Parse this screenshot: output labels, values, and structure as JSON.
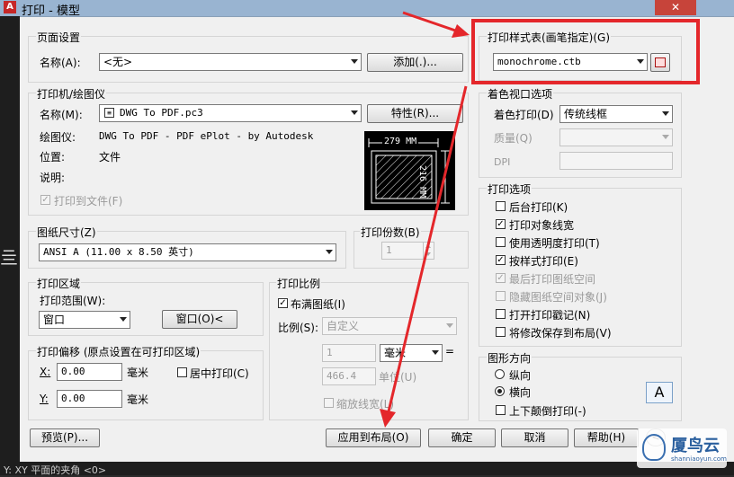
{
  "window": {
    "title": "打印 - 模型",
    "close_glyph": "✕",
    "app_icon": "autocad-icon"
  },
  "page_setup": {
    "group_title": "页面设置",
    "name_label": "名称(A):",
    "name_value": "<无>",
    "add_button": "添加(.)..."
  },
  "printer": {
    "group_title": "打印机/绘图仪",
    "name_label": "名称(M):",
    "name_value": "DWG To PDF.pc3",
    "properties_button": "特性(R)...",
    "plotter_label": "绘图仪:",
    "plotter_value": "DWG To PDF - PDF ePlot - by Autodesk",
    "location_label": "位置:",
    "location_value": "文件",
    "description_label": "说明:",
    "plot_to_file_label": "打印到文件(F)",
    "preview_width": "279 MM",
    "preview_height": "216 MM"
  },
  "paper_size": {
    "group_title": "图纸尺寸(Z)",
    "value": "ANSI A (11.00 x 8.50 英寸)"
  },
  "copies": {
    "group_title": "打印份数(B)",
    "value": "1"
  },
  "plot_area": {
    "group_title": "打印区域",
    "what_label": "打印范围(W):",
    "what_value": "窗口",
    "window_button": "窗口(O)<"
  },
  "plot_offset": {
    "group_title": "打印偏移 (原点设置在可打印区域)",
    "x_label": "X:",
    "x_value": "0.00",
    "y_label": "Y:",
    "y_value": "0.00",
    "unit_x": "毫米",
    "unit_y": "毫米",
    "center_label": "居中打印(C)"
  },
  "plot_scale": {
    "group_title": "打印比例",
    "fit_label": "布满图纸(I)",
    "scale_label": "比例(S):",
    "scale_value": "自定义",
    "value1": "1",
    "unit_value": "毫米",
    "equals": "=",
    "value2": "466.4",
    "unit2": "单位(U)",
    "lineweights_label": "缩放线宽(L)"
  },
  "plot_style_table": {
    "group_title": "打印样式表(画笔指定)(G)",
    "value": "monochrome.ctb",
    "edit_icon": "edit-table-icon"
  },
  "shaded_viewport": {
    "group_title": "着色视口选项",
    "shade_label": "着色打印(D)",
    "shade_value": "传统线框",
    "quality_label": "质量(Q)",
    "dpi_label": "DPI"
  },
  "plot_options": {
    "group_title": "打印选项",
    "items": [
      {
        "label": "后台打印(K)",
        "checked": false,
        "disabled": false
      },
      {
        "label": "打印对象线宽",
        "checked": true,
        "disabled": false
      },
      {
        "label": "使用透明度打印(T)",
        "checked": false,
        "disabled": false
      },
      {
        "label": "按样式打印(E)",
        "checked": true,
        "disabled": false
      },
      {
        "label": "最后打印图纸空间",
        "checked": true,
        "disabled": true
      },
      {
        "label": "隐藏图纸空间对象(J)",
        "checked": false,
        "disabled": true
      },
      {
        "label": "打开打印戳记(N)",
        "checked": false,
        "disabled": false
      },
      {
        "label": "将修改保存到布局(V)",
        "checked": false,
        "disabled": false
      }
    ]
  },
  "orientation": {
    "group_title": "图形方向",
    "portrait_label": "纵向",
    "landscape_label": "横向",
    "upside_down_label": "上下颠倒打印(-)",
    "selected": "横向",
    "page_icon_letter": "A"
  },
  "buttons": {
    "preview": "预览(P)...",
    "apply_to_layout": "应用到布局(O)",
    "ok": "确定",
    "cancel": "取消",
    "help": "帮助(H)"
  },
  "overlay": {
    "watermark_text": "厦鸟云",
    "watermark_sub": "shanniaoyun.com",
    "bottom_text": "Y: XY 平面的夹角 <0>",
    "highlight_color": "#e4272b",
    "arrow_color": "#e4272b"
  }
}
